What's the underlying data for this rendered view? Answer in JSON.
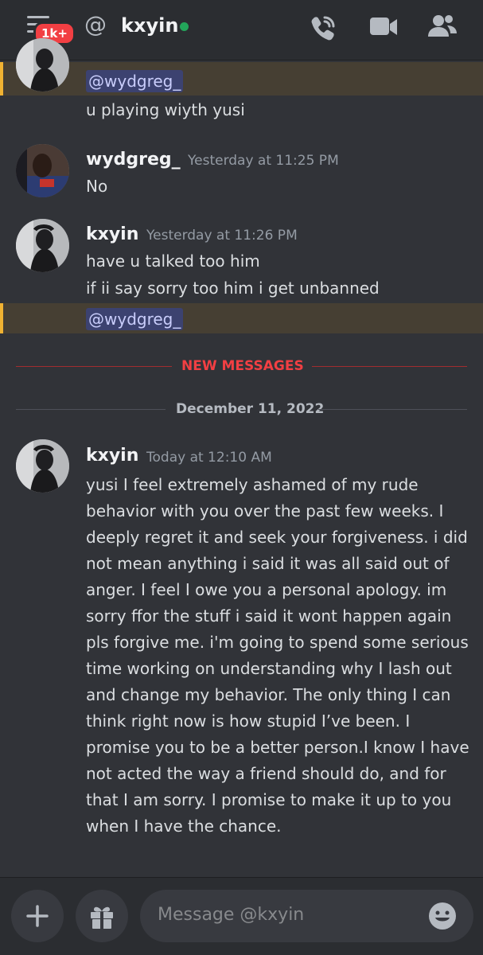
{
  "header": {
    "notification_badge": "1k+",
    "at_symbol": "@",
    "username": "kxyin",
    "status": "online",
    "icons": [
      "menu-icon",
      "phone-call-icon",
      "video-camera-icon",
      "members-icon"
    ]
  },
  "messages": [
    {
      "type": "partial",
      "mention": "@wydgreg_",
      "lines": [
        "u playing  wiyth   yusi"
      ]
    },
    {
      "type": "full",
      "author": "wydgreg_",
      "timestamp": "Yesterday at 11:25 PM",
      "lines": [
        "No"
      ]
    },
    {
      "type": "full",
      "author": "kxyin",
      "timestamp": "Yesterday at 11:26 PM",
      "lines": [
        "have  u  talked too him",
        "if  ii  say sorry too  him i  get unbanned"
      ],
      "mention": "@wydgreg_"
    },
    {
      "type": "full",
      "author": "kxyin",
      "timestamp": "Today at 12:10 AM",
      "body": "yusi I feel extremely ashamed of my rude behavior with you over the past few weeks. I deeply regret it and seek your forgiveness. i did not mean anything i said it was all said out of anger. I feel I owe you a personal apology. im sorry ffor the  stuff i said it  wont   happen again pls  forgive me. i'm going to spend some serious time working on understanding why I lash out and change my behavior. The only thing I can think right now is how stupid I’ve been. I promise you to be a better person.I know I have not acted the way a friend should do, and for that I am sorry. I promise to make it up to you when I have the chance."
    }
  ],
  "dividers": {
    "new_messages": "NEW MESSAGES",
    "date": "December 11, 2022"
  },
  "composer": {
    "placeholder": "Message @kxyin",
    "add_icon": "plus-icon",
    "gift_icon": "gift-icon",
    "emoji_icon": "emoji-icon"
  },
  "colors": {
    "background": "#313338",
    "header": "#2b2d31",
    "online": "#23a55a",
    "badge": "#f23f43",
    "new_messages_red": "#f23f43",
    "mention_bg": "#3c4270",
    "highlight": "#463f33",
    "highlight_bar": "#f0b232"
  }
}
